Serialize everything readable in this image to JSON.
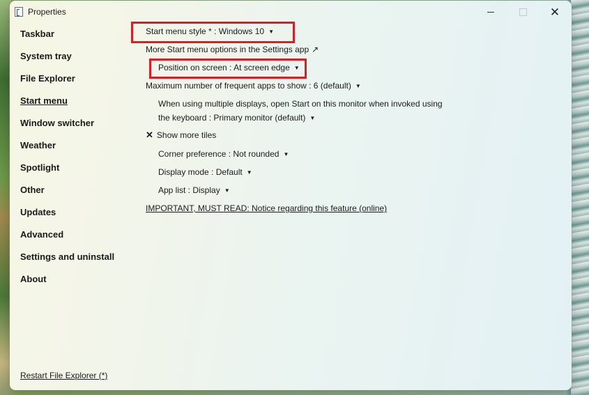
{
  "window": {
    "title": "Properties",
    "close_glyph": "✕"
  },
  "sidebar": {
    "items": [
      {
        "label": "Taskbar",
        "active": false
      },
      {
        "label": "System tray",
        "active": false
      },
      {
        "label": "File Explorer",
        "active": false
      },
      {
        "label": "Start menu",
        "active": true
      },
      {
        "label": "Window switcher",
        "active": false
      },
      {
        "label": "Weather",
        "active": false
      },
      {
        "label": "Spotlight",
        "active": false
      },
      {
        "label": "Other",
        "active": false
      },
      {
        "label": "Updates",
        "active": false
      },
      {
        "label": "Advanced",
        "active": false
      },
      {
        "label": "Settings and uninstall",
        "active": false
      },
      {
        "label": "About",
        "active": false
      }
    ],
    "restart_link": "Restart File Explorer (*)"
  },
  "main": {
    "start_menu_style": "Start menu style * : Windows 10",
    "more_options": "More Start menu options in the Settings app",
    "more_options_arrow": "↗",
    "position_on_screen": "Position on screen : At screen edge",
    "max_frequent_apps": "Maximum number of frequent apps to show : 6 (default)",
    "multi_display_line1": "When using multiple displays, open Start on this monitor when invoked using",
    "multi_display_line2": "the keyboard : Primary monitor (default)",
    "show_more_tiles_mark": "✕",
    "show_more_tiles": "Show more tiles",
    "corner_preference": "Corner preference : Not rounded",
    "display_mode": "Display mode : Default",
    "app_list": "App list : Display",
    "important_link": "IMPORTANT, MUST READ: Notice regarding this feature (online)",
    "caret": "▼"
  },
  "colors": {
    "highlight_box": "#e01b24",
    "text": "#1a1a1a"
  }
}
